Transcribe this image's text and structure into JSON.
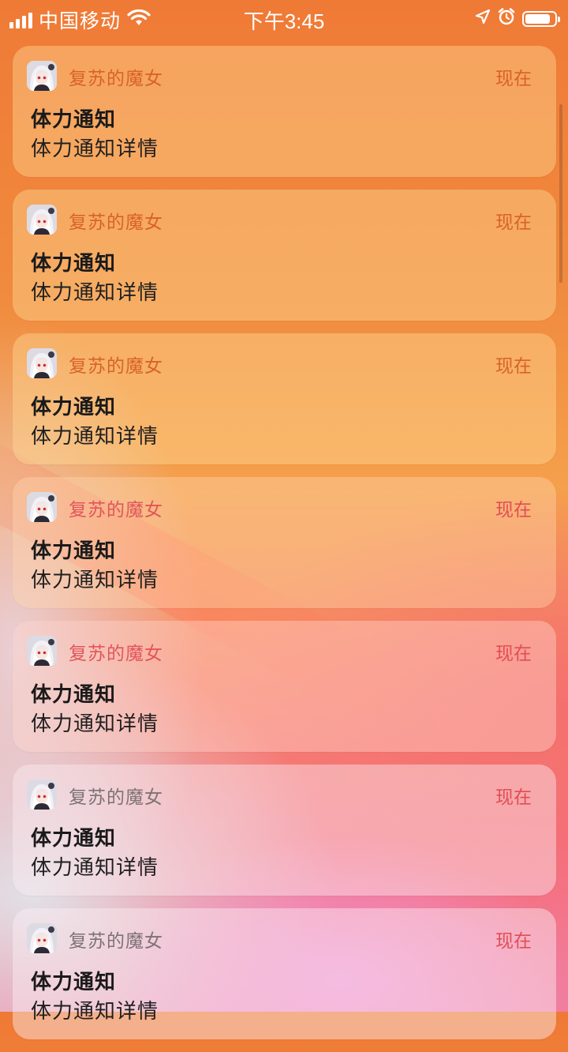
{
  "status_bar": {
    "carrier": "中国移动",
    "time": "下午3:45",
    "signal_bars": 4,
    "battery_level": 0.85,
    "icons": [
      "cellular-signal-icon",
      "wifi-icon",
      "location-arrow-icon",
      "alarm-clock-icon",
      "battery-icon"
    ]
  },
  "notifications": [
    {
      "app": "复苏的魔女",
      "time": "现在",
      "title": "体力通知",
      "body": "体力通知详情"
    },
    {
      "app": "复苏的魔女",
      "time": "现在",
      "title": "体力通知",
      "body": "体力通知详情"
    },
    {
      "app": "复苏的魔女",
      "time": "现在",
      "title": "体力通知",
      "body": "体力通知详情"
    },
    {
      "app": "复苏的魔女",
      "time": "现在",
      "title": "体力通知",
      "body": "体力通知详情"
    },
    {
      "app": "复苏的魔女",
      "time": "现在",
      "title": "体力通知",
      "body": "体力通知详情"
    },
    {
      "app": "复苏的魔女",
      "time": "现在",
      "title": "体力通知",
      "body": "体力通知详情"
    },
    {
      "app": "复苏的魔女",
      "time": "现在",
      "title": "体力通知",
      "body": "体力通知详情"
    }
  ],
  "colors": {
    "app_name_orange": "#d8622a",
    "time_red": "#e24d55",
    "app_name_gray": "#7d7275"
  }
}
